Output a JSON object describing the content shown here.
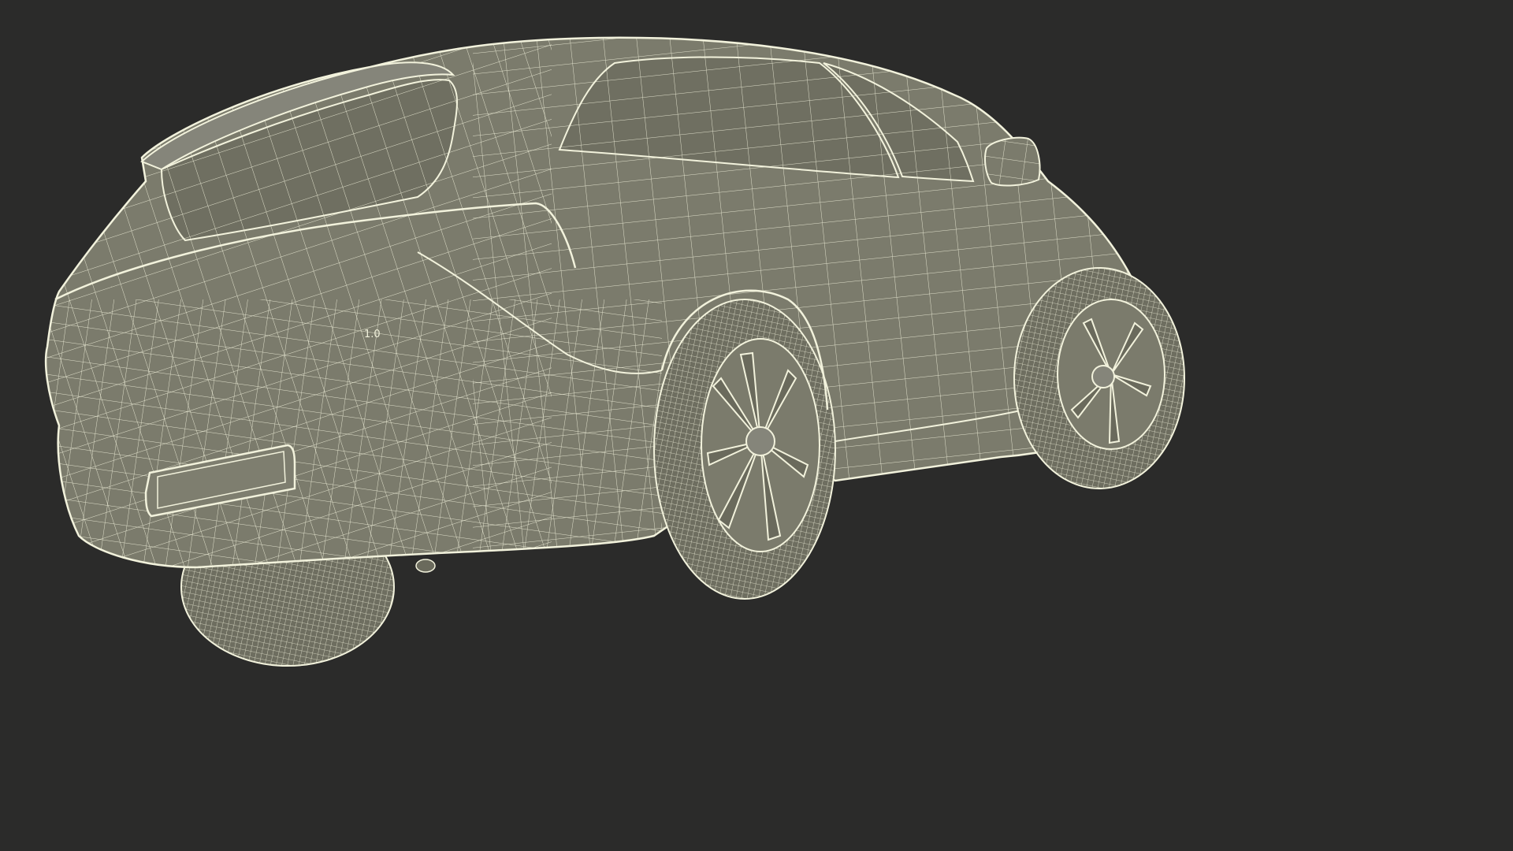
{
  "scene": {
    "subject": "suv-wireframe-render",
    "view": "rear-three-quarter-low-angle"
  },
  "colors": {
    "background": "#2b2b2a",
    "surface": "#7b7b6c",
    "surface_shadow": "#6a6a5c",
    "surface_light": "#8a8a7a",
    "wire": "#f2f2dc",
    "tire": "#6e6e60"
  },
  "badges": {
    "rear_model_mark": "1.0"
  }
}
